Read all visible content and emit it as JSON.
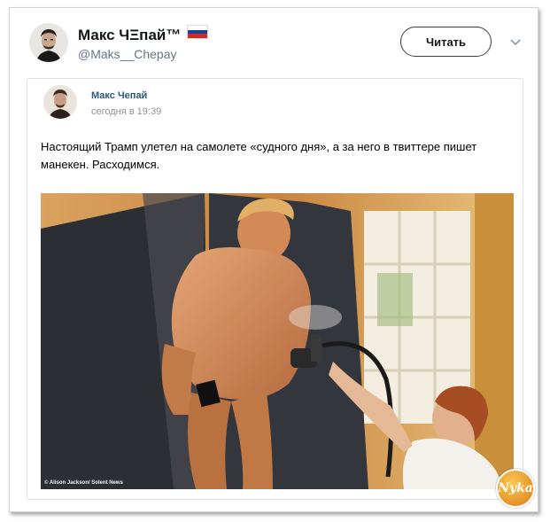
{
  "tweet": {
    "author_name": "Макс ЧΞпай™",
    "author_handle": "@Maks__Chepay",
    "follow_label": "Читать",
    "menu_icon": "chevron-down-icon",
    "flag_colors": [
      "#ffffff",
      "#1c3fa0",
      "#d52b1e"
    ]
  },
  "embedded_post": {
    "author_name": "Макс Чепай",
    "timestamp": "сегодня в 19:39",
    "text": "Настоящий Трамп улетел на самолете «судного дня», а за него в твиттере пишет манекен. Расходимся.",
    "image_credit": "© Alison Jackson/ Solent News"
  },
  "watermark": {
    "text": "Nyka"
  }
}
